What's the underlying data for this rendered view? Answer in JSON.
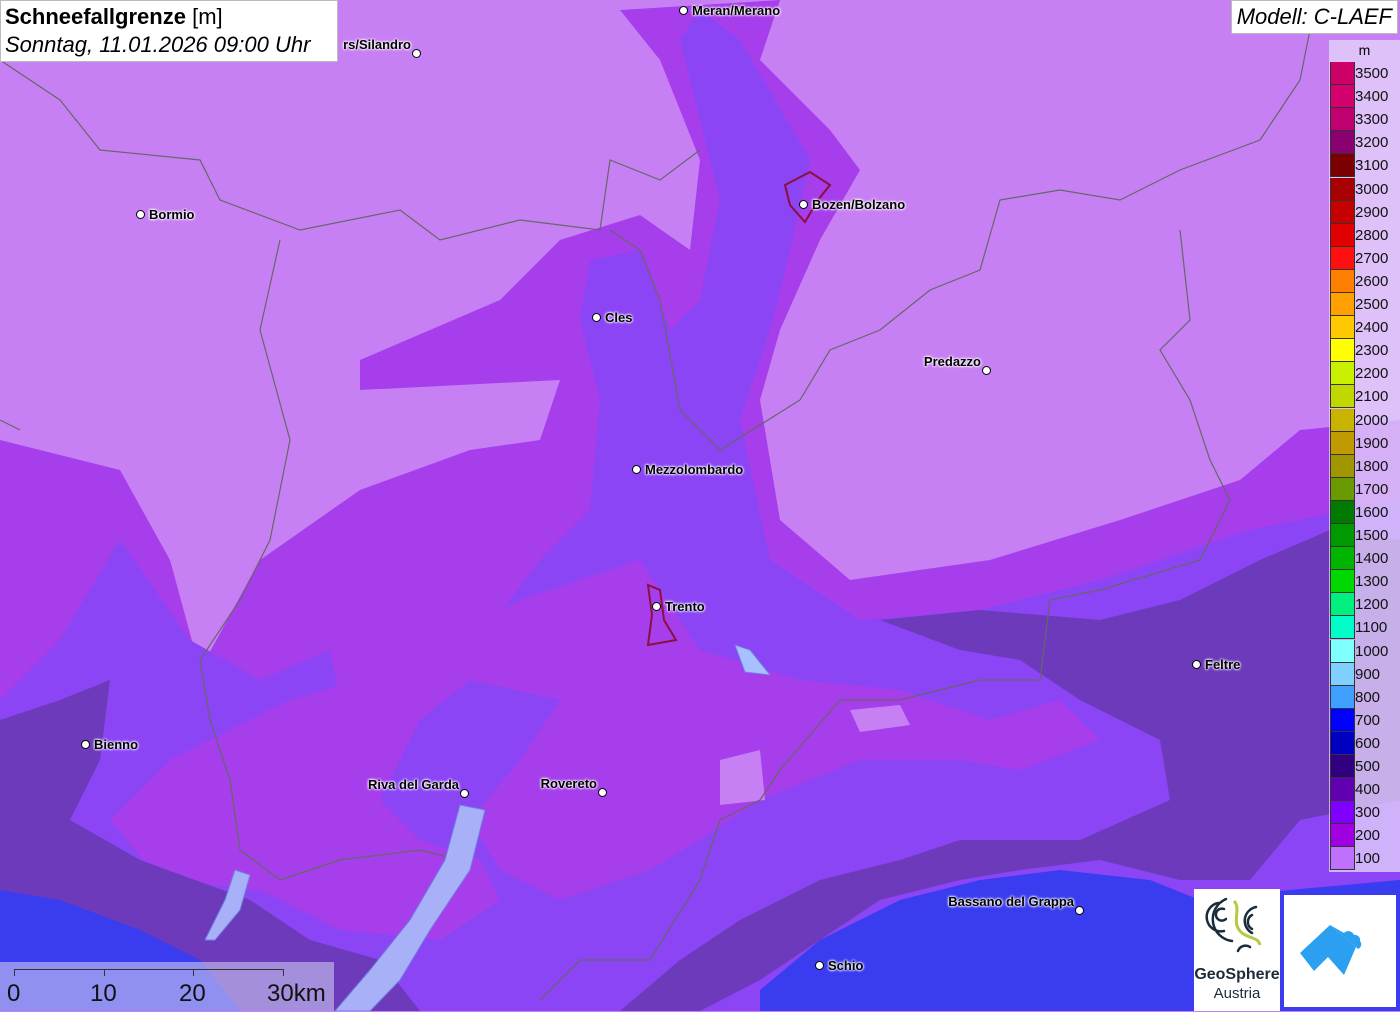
{
  "title": {
    "main": "Schneefallgrenze",
    "unit": "[m]",
    "datetime": "Sonntag, 11.01.2026 09:00 Uhr"
  },
  "model": "Modell: C-LAEF",
  "legend": {
    "unit": "m",
    "entries": [
      {
        "label": "3500",
        "color": "#cc0066"
      },
      {
        "label": "3400",
        "color": "#d4006e"
      },
      {
        "label": "3300",
        "color": "#c00070"
      },
      {
        "label": "3200",
        "color": "#8a0070"
      },
      {
        "label": "3100",
        "color": "#7a0000"
      },
      {
        "label": "3000",
        "color": "#a80000"
      },
      {
        "label": "2900",
        "color": "#c40000"
      },
      {
        "label": "2800",
        "color": "#e00000"
      },
      {
        "label": "2700",
        "color": "#ff1010"
      },
      {
        "label": "2600",
        "color": "#ff8000"
      },
      {
        "label": "2500",
        "color": "#ffa000"
      },
      {
        "label": "2400",
        "color": "#ffc800"
      },
      {
        "label": "2300",
        "color": "#ffff00"
      },
      {
        "label": "2200",
        "color": "#c8f000"
      },
      {
        "label": "2100",
        "color": "#c0d800"
      },
      {
        "label": "2000",
        "color": "#c8b400"
      },
      {
        "label": "1900",
        "color": "#c09a00"
      },
      {
        "label": "1800",
        "color": "#a09600"
      },
      {
        "label": "1700",
        "color": "#6a9a00"
      },
      {
        "label": "1600",
        "color": "#007a00"
      },
      {
        "label": "1500",
        "color": "#009a00"
      },
      {
        "label": "1400",
        "color": "#00b400"
      },
      {
        "label": "1300",
        "color": "#00d800"
      },
      {
        "label": "1200",
        "color": "#00f080"
      },
      {
        "label": "1100",
        "color": "#00ffc8"
      },
      {
        "label": "1000",
        "color": "#80ffff"
      },
      {
        "label": "900",
        "color": "#80d0ff"
      },
      {
        "label": "800",
        "color": "#40a0ff"
      },
      {
        "label": "700",
        "color": "#0000ff"
      },
      {
        "label": "600",
        "color": "#0000c0"
      },
      {
        "label": "500",
        "color": "#300080"
      },
      {
        "label": "400",
        "color": "#6000b0"
      },
      {
        "label": "300",
        "color": "#8000ff"
      },
      {
        "label": "200",
        "color": "#a000e0"
      },
      {
        "label": "100",
        "color": "#c070ff"
      }
    ]
  },
  "cities": [
    {
      "name": "Meran/Merano"
    },
    {
      "name": "rs/Silandro"
    },
    {
      "name": "Bormio"
    },
    {
      "name": "Bozen/Bolzano"
    },
    {
      "name": "Cles"
    },
    {
      "name": "Predazzo"
    },
    {
      "name": "Mezzolombardo"
    },
    {
      "name": "Trento"
    },
    {
      "name": "Feltre"
    },
    {
      "name": "Bienno"
    },
    {
      "name": "Riva del Garda"
    },
    {
      "name": "Rovereto"
    },
    {
      "name": "Bassano del Grappa"
    },
    {
      "name": "Schio"
    }
  ],
  "scale": {
    "labels": [
      "0",
      "10",
      "20",
      "30km"
    ]
  },
  "logos": {
    "geosphere_line1": "GeoSphere",
    "geosphere_line2": "Austria"
  },
  "colors": {
    "base": "#c780f4",
    "mid": "#a740ec",
    "violet": "#8c46f6",
    "dark": "#6a3ab8",
    "blue": "#3a3cf0"
  }
}
